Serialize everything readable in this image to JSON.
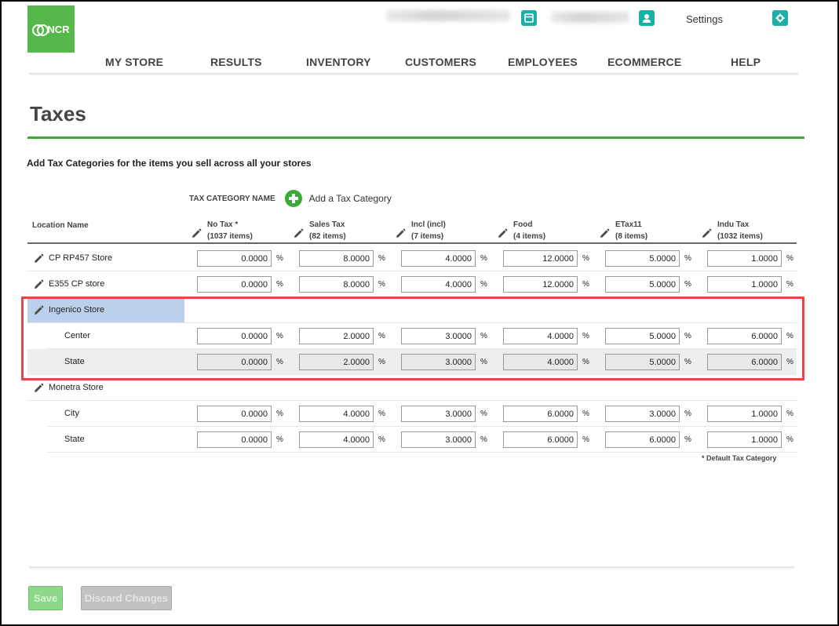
{
  "header": {
    "logo_text": "NCR",
    "settings_label": "Settings",
    "icons": [
      "store-icon",
      "user-icon",
      "gear-icon"
    ]
  },
  "nav": {
    "items": [
      {
        "label": "MY STORE"
      },
      {
        "label": "RESULTS"
      },
      {
        "label": "INVENTORY"
      },
      {
        "label": "CUSTOMERS"
      },
      {
        "label": "EMPLOYEES"
      },
      {
        "label": "ECOMMERCE"
      },
      {
        "label": "HELP"
      }
    ]
  },
  "page": {
    "title": "Taxes",
    "subtitle": "Add Tax Categories for the items you sell across all your stores",
    "tax_category_label": "TAX CATEGORY NAME",
    "add_category_label": "Add a Tax Category",
    "footnote": "* Default Tax Category"
  },
  "table": {
    "location_header": "Location Name",
    "percent_symbol": "%",
    "columns": [
      {
        "name": "No Tax *",
        "count": "(1037 items)"
      },
      {
        "name": "Sales Tax",
        "count": "(82 items)"
      },
      {
        "name": "Incl (incl)",
        "count": "(7 items)"
      },
      {
        "name": "Food",
        "count": "(4 items)"
      },
      {
        "name": "ETax11",
        "count": "(8 items)"
      },
      {
        "name": "Indu Tax",
        "count": "(1032 items)"
      }
    ],
    "rows": [
      {
        "type": "store",
        "name": "CP RP457 Store",
        "values": [
          "0.0000",
          "8.0000",
          "4.0000",
          "12.0000",
          "5.0000",
          "1.0000"
        ]
      },
      {
        "type": "store",
        "name": "E355 CP store",
        "values": [
          "0.0000",
          "8.0000",
          "4.0000",
          "12.0000",
          "5.0000",
          "1.0000"
        ]
      },
      {
        "type": "group",
        "name": "Ingenico Store",
        "selected": true
      },
      {
        "type": "sub",
        "name": "Center",
        "values": [
          "0.0000",
          "2.0000",
          "3.0000",
          "4.0000",
          "5.0000",
          "6.0000"
        ]
      },
      {
        "type": "sub",
        "name": "State",
        "shaded": true,
        "values": [
          "0.0000",
          "2.0000",
          "3.0000",
          "4.0000",
          "5.0000",
          "6.0000"
        ]
      },
      {
        "type": "group",
        "name": "Monetra Store"
      },
      {
        "type": "sub",
        "name": "City",
        "values": [
          "0.0000",
          "4.0000",
          "3.0000",
          "6.0000",
          "3.0000",
          "1.0000"
        ]
      },
      {
        "type": "sub",
        "name": "State",
        "values": [
          "0.0000",
          "4.0000",
          "3.0000",
          "6.0000",
          "6.0000",
          "1.0000"
        ]
      }
    ]
  },
  "footer": {
    "save_label": "Save",
    "discard_label": "Discard Changes"
  },
  "colors": {
    "brand_green": "#54b948",
    "accent_teal": "#1ab0a8",
    "highlight_red": "#e84545",
    "selected_row": "#bcd0ec"
  }
}
